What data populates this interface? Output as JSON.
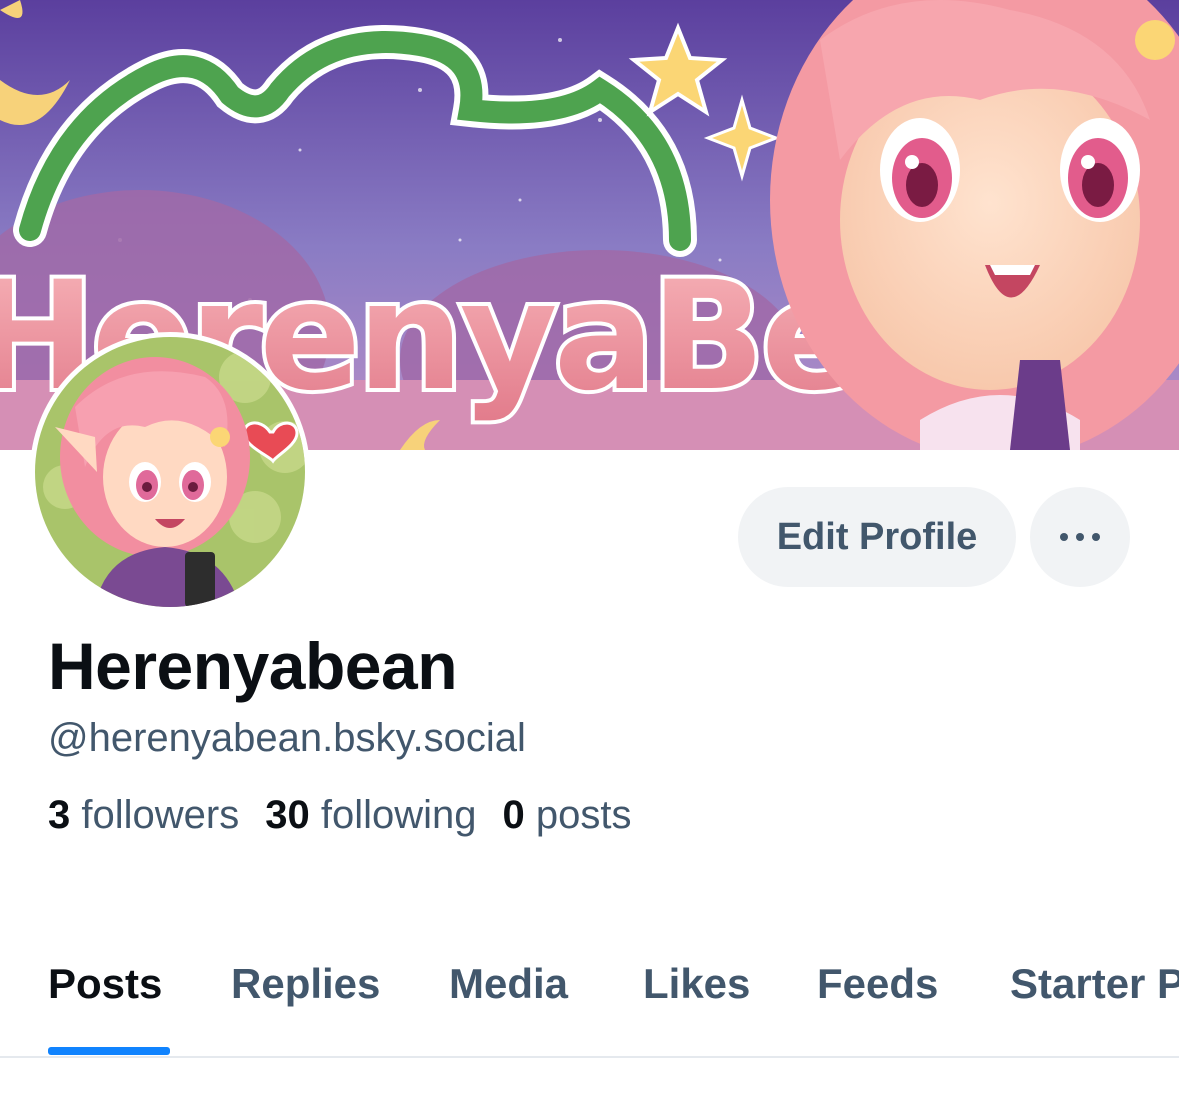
{
  "banner": {
    "wordmark": "HerenyaBean",
    "colors": {
      "sky_top": "#5b3f9e",
      "sky_bottom": "#b88fc8",
      "ground": "#d58fb5",
      "letters": "#ef98a3",
      "arc": "#4ea34f",
      "hair": "#f49aa3"
    }
  },
  "avatar": {
    "icon": "profile-avatar-illustration",
    "background": "#a9c46a"
  },
  "actions": {
    "edit_profile_label": "Edit Profile",
    "more_icon": "ellipsis-icon"
  },
  "profile": {
    "display_name": "Herenyabean",
    "handle": "@herenyabean.bsky.social"
  },
  "stats": [
    {
      "count": "3",
      "label": "followers"
    },
    {
      "count": "30",
      "label": "following"
    },
    {
      "count": "0",
      "label": "posts"
    }
  ],
  "tabs": [
    {
      "label": "Posts",
      "active": true
    },
    {
      "label": "Replies",
      "active": false
    },
    {
      "label": "Media",
      "active": false
    },
    {
      "label": "Likes",
      "active": false
    },
    {
      "label": "Feeds",
      "active": false
    },
    {
      "label": "Starter Packs",
      "active": false
    }
  ],
  "colors": {
    "accent": "#1083fe",
    "text_primary": "#0b0f14",
    "text_secondary": "#42576c",
    "button_bg": "#f1f3f5"
  }
}
